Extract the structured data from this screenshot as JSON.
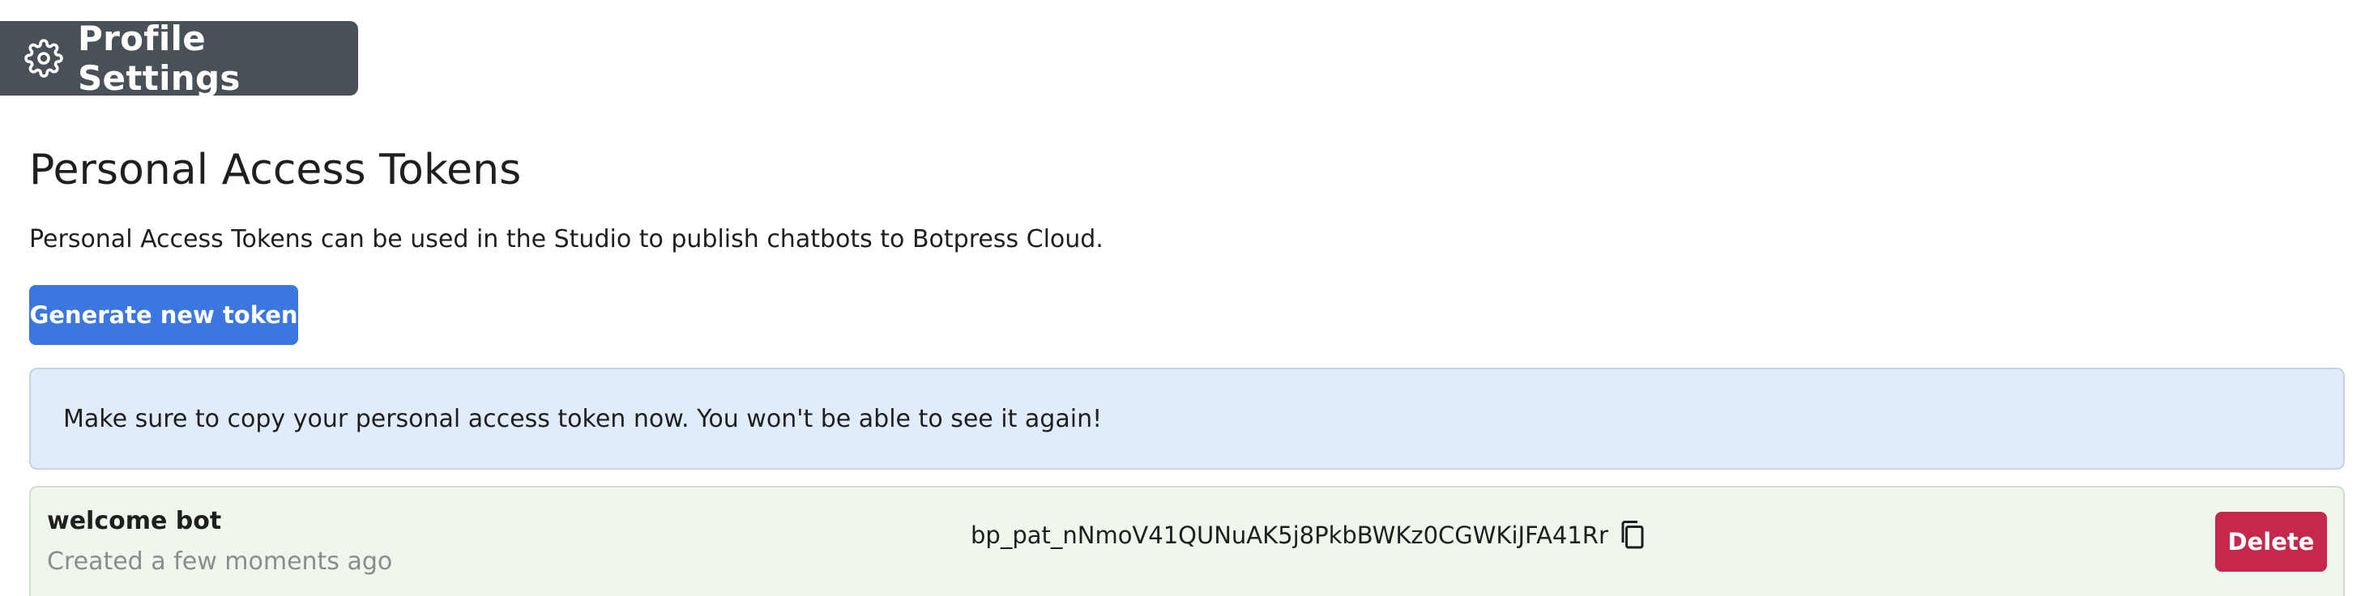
{
  "header": {
    "title": "Profile Settings",
    "icon": "gear-icon"
  },
  "section": {
    "title": "Personal Access Tokens",
    "description": "Personal Access Tokens can be used in the Studio to publish chatbots to Botpress Cloud.",
    "generate_label": "Generate new token"
  },
  "alert": {
    "message": "Make sure to copy your personal access token now. You won't be able to see it again!"
  },
  "tokens": [
    {
      "name": "welcome bot",
      "created": "Created a few moments ago",
      "value": "bp_pat_nNmoV41QUNuAK5j8PkbBWKz0CGWKiJFA41Rr",
      "copy_icon": "copy-icon",
      "delete_label": "Delete"
    }
  ],
  "colors": {
    "header_bg": "#4a5058",
    "primary": "#3b76e1",
    "alert_bg": "#e0ecfb",
    "token_bg": "#eff6ec",
    "danger": "#c5284b"
  }
}
